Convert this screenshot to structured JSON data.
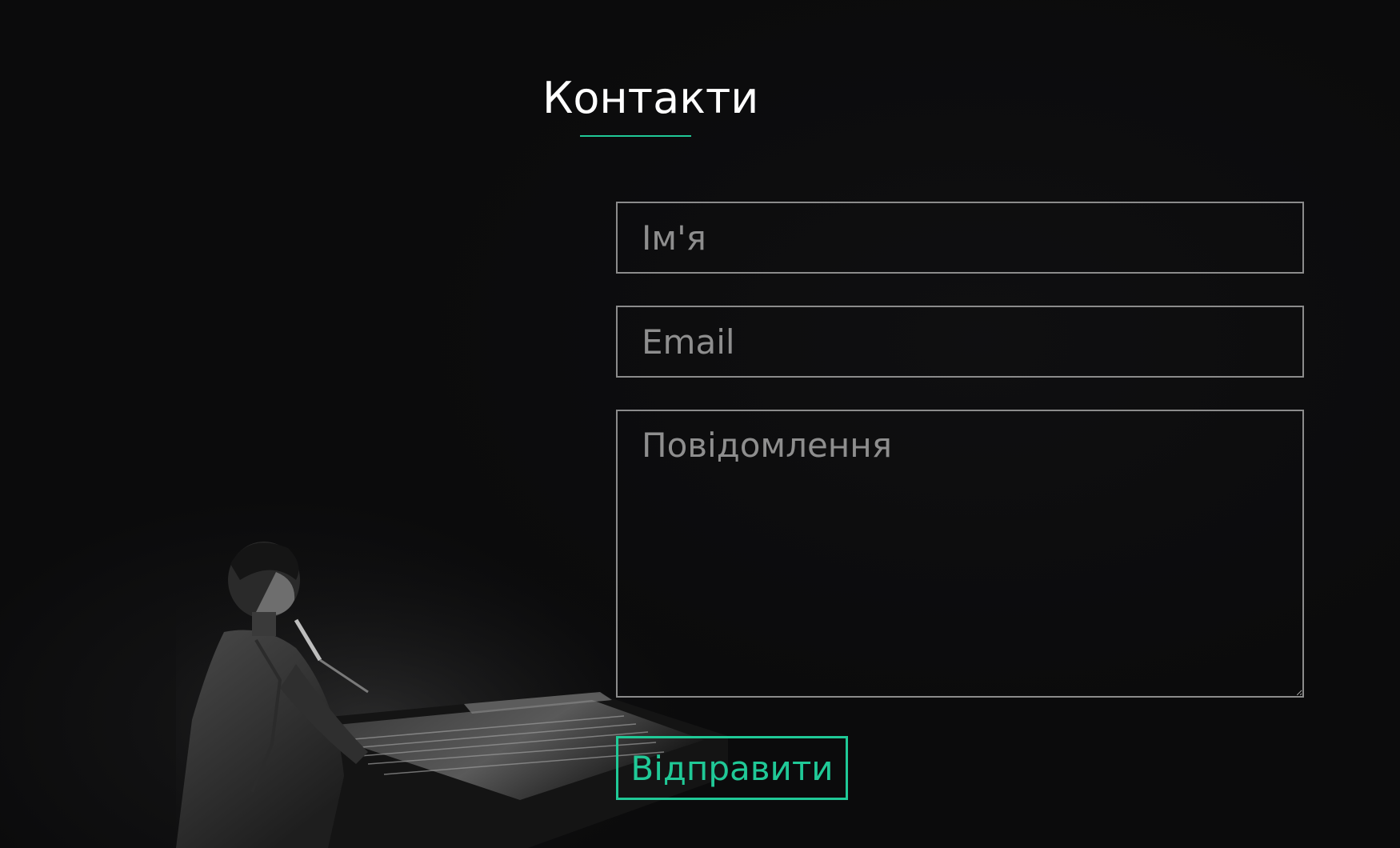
{
  "contact": {
    "title": "Контакти",
    "name_placeholder": "Ім'я",
    "email_placeholder": "Email",
    "message_placeholder": "Повідомлення",
    "submit_label": "Відправити"
  },
  "colors": {
    "background": "#0b0b0c",
    "accent": "#20c997",
    "field_border": "#8b8b8b",
    "placeholder": "#8e8e8e",
    "title": "#ffffff"
  },
  "background_image": {
    "subject": "pianist-with-microphone"
  }
}
